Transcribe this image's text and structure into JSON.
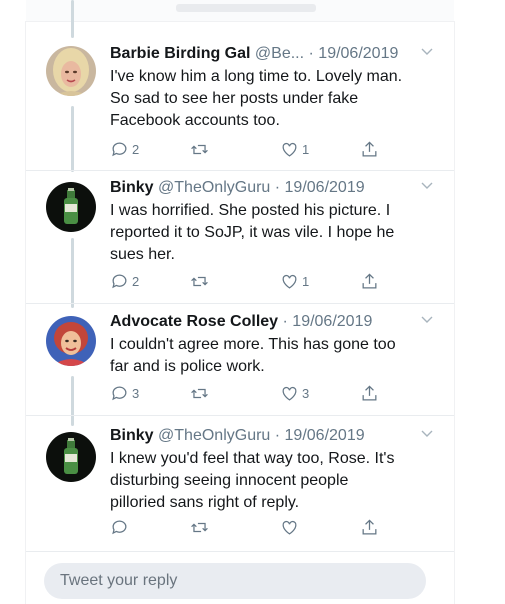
{
  "thread": {
    "tweets": [
      {
        "name": "Barbie Birding Gal",
        "meta": "@Be... · 19/06/2019",
        "text_lines": [
          "I've know him a long time to.  Lovely man.",
          "So sad to see her posts under fake",
          "Facebook accounts too."
        ],
        "replies": "2",
        "retweets": "",
        "likes": "1",
        "avatar_icon": "blonde-woman-portrait-avatar"
      },
      {
        "name": "Binky",
        "meta": "@TheOnlyGuru · 19/06/2019",
        "text_lines": [
          "I was horrified. She posted his picture. I",
          "reported it to SoJP, it was vile. I hope he",
          "sues her."
        ],
        "replies": "2",
        "retweets": "",
        "likes": "1",
        "avatar_icon": "green-bottle-avatar"
      },
      {
        "name": "Advocate Rose Colley",
        "meta": "· 19/06/2019",
        "text_lines": [
          "I couldn't agree more. This has gone too",
          "far and is police work."
        ],
        "replies": "3",
        "retweets": "",
        "likes": "3",
        "avatar_icon": "red-hair-woman-avatar"
      },
      {
        "name": "Binky",
        "meta": "@TheOnlyGuru · 19/06/2019",
        "text_lines": [
          "I knew you'd feel that way too, Rose. It's",
          "disturbing seeing innocent people",
          "pilloried sans right of reply."
        ],
        "replies": "",
        "retweets": "",
        "likes": "",
        "avatar_icon": "green-bottle-avatar"
      }
    ]
  },
  "reply": {
    "placeholder": "Tweet your reply"
  },
  "icons": {
    "reply": "reply-icon",
    "retweet": "retweet-icon",
    "like": "heart-icon",
    "share": "share-icon",
    "more": "chevron-down-icon"
  },
  "colors": {
    "text": "#14171a",
    "muted": "#657786",
    "thread_line": "#cfd9de",
    "reply_box": "#e9ecf1"
  }
}
